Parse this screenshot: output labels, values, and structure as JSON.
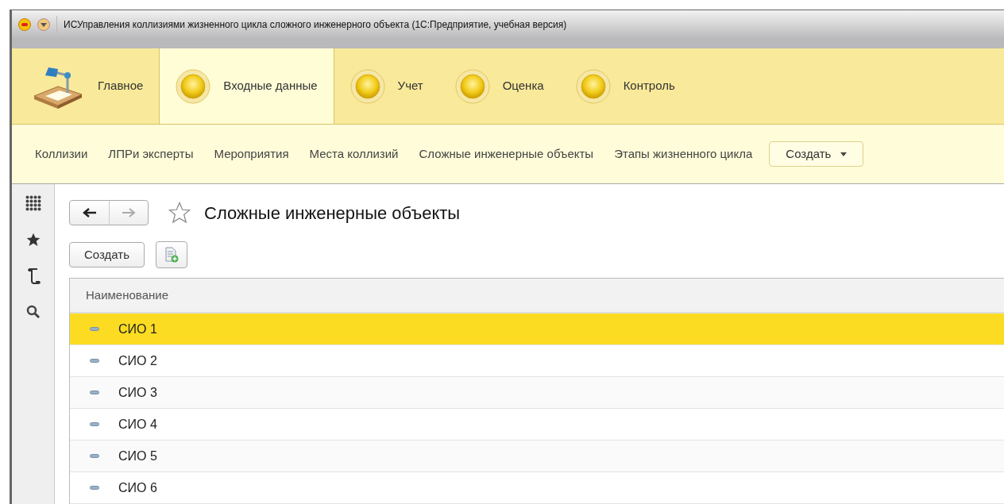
{
  "window": {
    "title": "ИСУправления коллизиями жизненного цикла сложного инженерного объекта  (1С:Предприятие, учебная версия)"
  },
  "sections": [
    {
      "label": "Главное",
      "kind": "home",
      "selected": false
    },
    {
      "label": "Входные данные",
      "kind": "section",
      "selected": true
    },
    {
      "label": "Учет",
      "kind": "section",
      "selected": false
    },
    {
      "label": "Оценка",
      "kind": "section",
      "selected": false
    },
    {
      "label": "Контроль",
      "kind": "section",
      "selected": false
    }
  ],
  "nav_links": [
    "Коллизии",
    "ЛПРи эксперты",
    "Мероприятия",
    "Места коллизий",
    "Сложные инженерные объекты",
    "Этапы жизненного цикла"
  ],
  "nav_create": "Создать",
  "form": {
    "title": "Сложные инженерные объекты",
    "create_button": "Создать",
    "table": {
      "columns": [
        "Наименование"
      ],
      "rows": [
        {
          "name": "СИО 1",
          "selected": true
        },
        {
          "name": "СИО 2",
          "selected": false
        },
        {
          "name": "СИО 3",
          "selected": false
        },
        {
          "name": "СИО 4",
          "selected": false
        },
        {
          "name": "СИО 5",
          "selected": false
        },
        {
          "name": "СИО 6",
          "selected": false
        }
      ]
    }
  }
}
